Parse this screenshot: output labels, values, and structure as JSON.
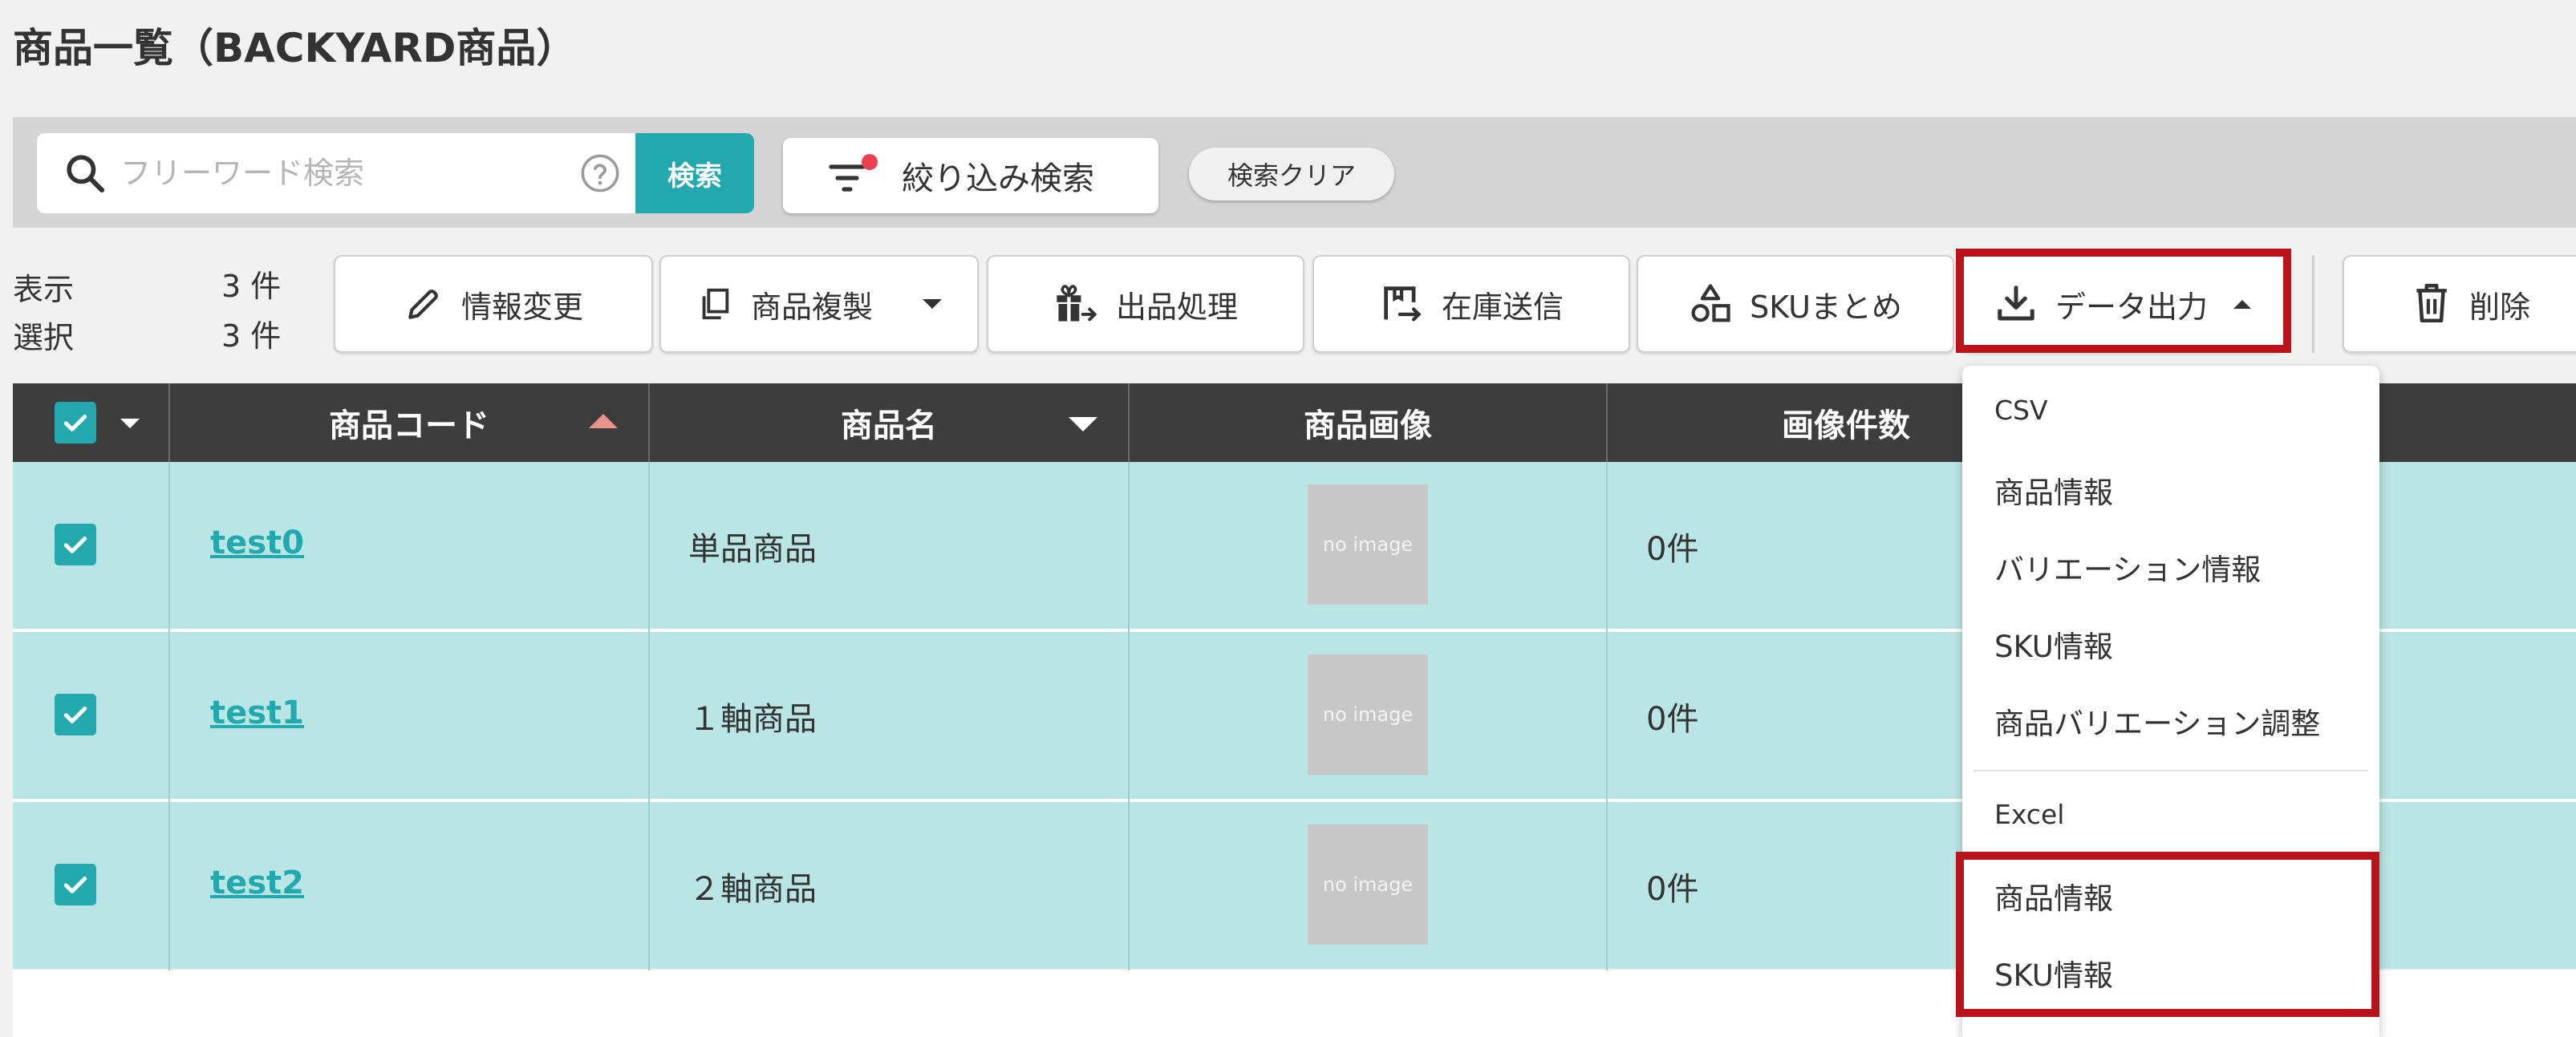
{
  "page": {
    "title": "商品一覧（BACKYARD商品）"
  },
  "search": {
    "placeholder": "フリーワード検索",
    "value": "",
    "button_label": "検索",
    "filter_label": "絞り込み検索",
    "clear_label": "検索クリア"
  },
  "counts": {
    "display_label": "表示",
    "display_value": "3 件",
    "selected_label": "選択",
    "selected_value": "3 件"
  },
  "toolbar": {
    "edit_label": "情報変更",
    "duplicate_label": "商品複製",
    "listing_label": "出品処理",
    "stock_label": "在庫送信",
    "sku_label": "SKUまとめ",
    "export_label": "データ出力",
    "delete_label": "削除"
  },
  "table": {
    "columns": {
      "code": "商品コード",
      "name": "商品名",
      "image": "商品画像",
      "image_count": "画像件数"
    },
    "rows": [
      {
        "code": "test0",
        "name": "単品商品",
        "image": "no image",
        "image_count": "0件",
        "checked": true
      },
      {
        "code": "test1",
        "name": "１軸商品",
        "image": "no image",
        "image_count": "0件",
        "checked": true
      },
      {
        "code": "test2",
        "name": "２軸商品",
        "image": "no image",
        "image_count": "0件",
        "checked": true
      }
    ]
  },
  "export_menu": {
    "csv_header": "CSV",
    "csv_items": [
      "商品情報",
      "バリエーション情報",
      "SKU情報",
      "商品バリエーション調整"
    ],
    "excel_header": "Excel",
    "excel_items": [
      "商品情報",
      "SKU情報"
    ]
  },
  "colors": {
    "accent": "#23a9ad",
    "header_bg": "#3d3d3d",
    "row_selected": "#b9e5e4",
    "highlight": "#b8121b",
    "filter_badge": "#e9414f"
  }
}
